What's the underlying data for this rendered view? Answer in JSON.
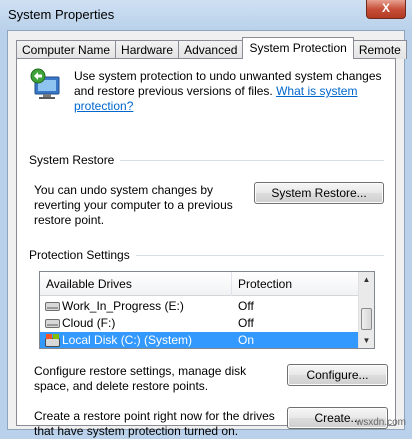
{
  "window": {
    "title": "System Properties",
    "close_label": "X"
  },
  "tabs": [
    {
      "label": "Computer Name",
      "active": false
    },
    {
      "label": "Hardware",
      "active": false
    },
    {
      "label": "Advanced",
      "active": false
    },
    {
      "label": "System Protection",
      "active": true
    },
    {
      "label": "Remote",
      "active": false
    }
  ],
  "intro": {
    "text": "Use system protection to undo unwanted system changes and restore previous versions of files.",
    "link": "What is system protection?"
  },
  "system_restore": {
    "group_label": "System Restore",
    "description": "You can undo system changes by reverting your computer to a previous restore point.",
    "button": "System Restore..."
  },
  "protection_settings": {
    "group_label": "Protection Settings",
    "columns": [
      "Available Drives",
      "Protection"
    ],
    "drives": [
      {
        "name": "Work_In_Progress (E:)",
        "protection": "Off",
        "selected": false,
        "icon": "hard-drive-icon"
      },
      {
        "name": "Cloud (F:)",
        "protection": "Off",
        "selected": false,
        "icon": "hard-drive-icon"
      },
      {
        "name": "Local Disk (C:) (System)",
        "protection": "On",
        "selected": true,
        "icon": "system-drive-icon"
      }
    ],
    "configure_text": "Configure restore settings, manage disk space, and delete restore points.",
    "configure_button": "Configure...",
    "create_text": "Create a restore point right now for the drives that have system protection turned on.",
    "create_button": "Create..."
  },
  "watermark": "wsxdn.com",
  "colors": {
    "selection": "#3399ff",
    "link": "#0066cc",
    "frame": "#b9d1ea"
  }
}
